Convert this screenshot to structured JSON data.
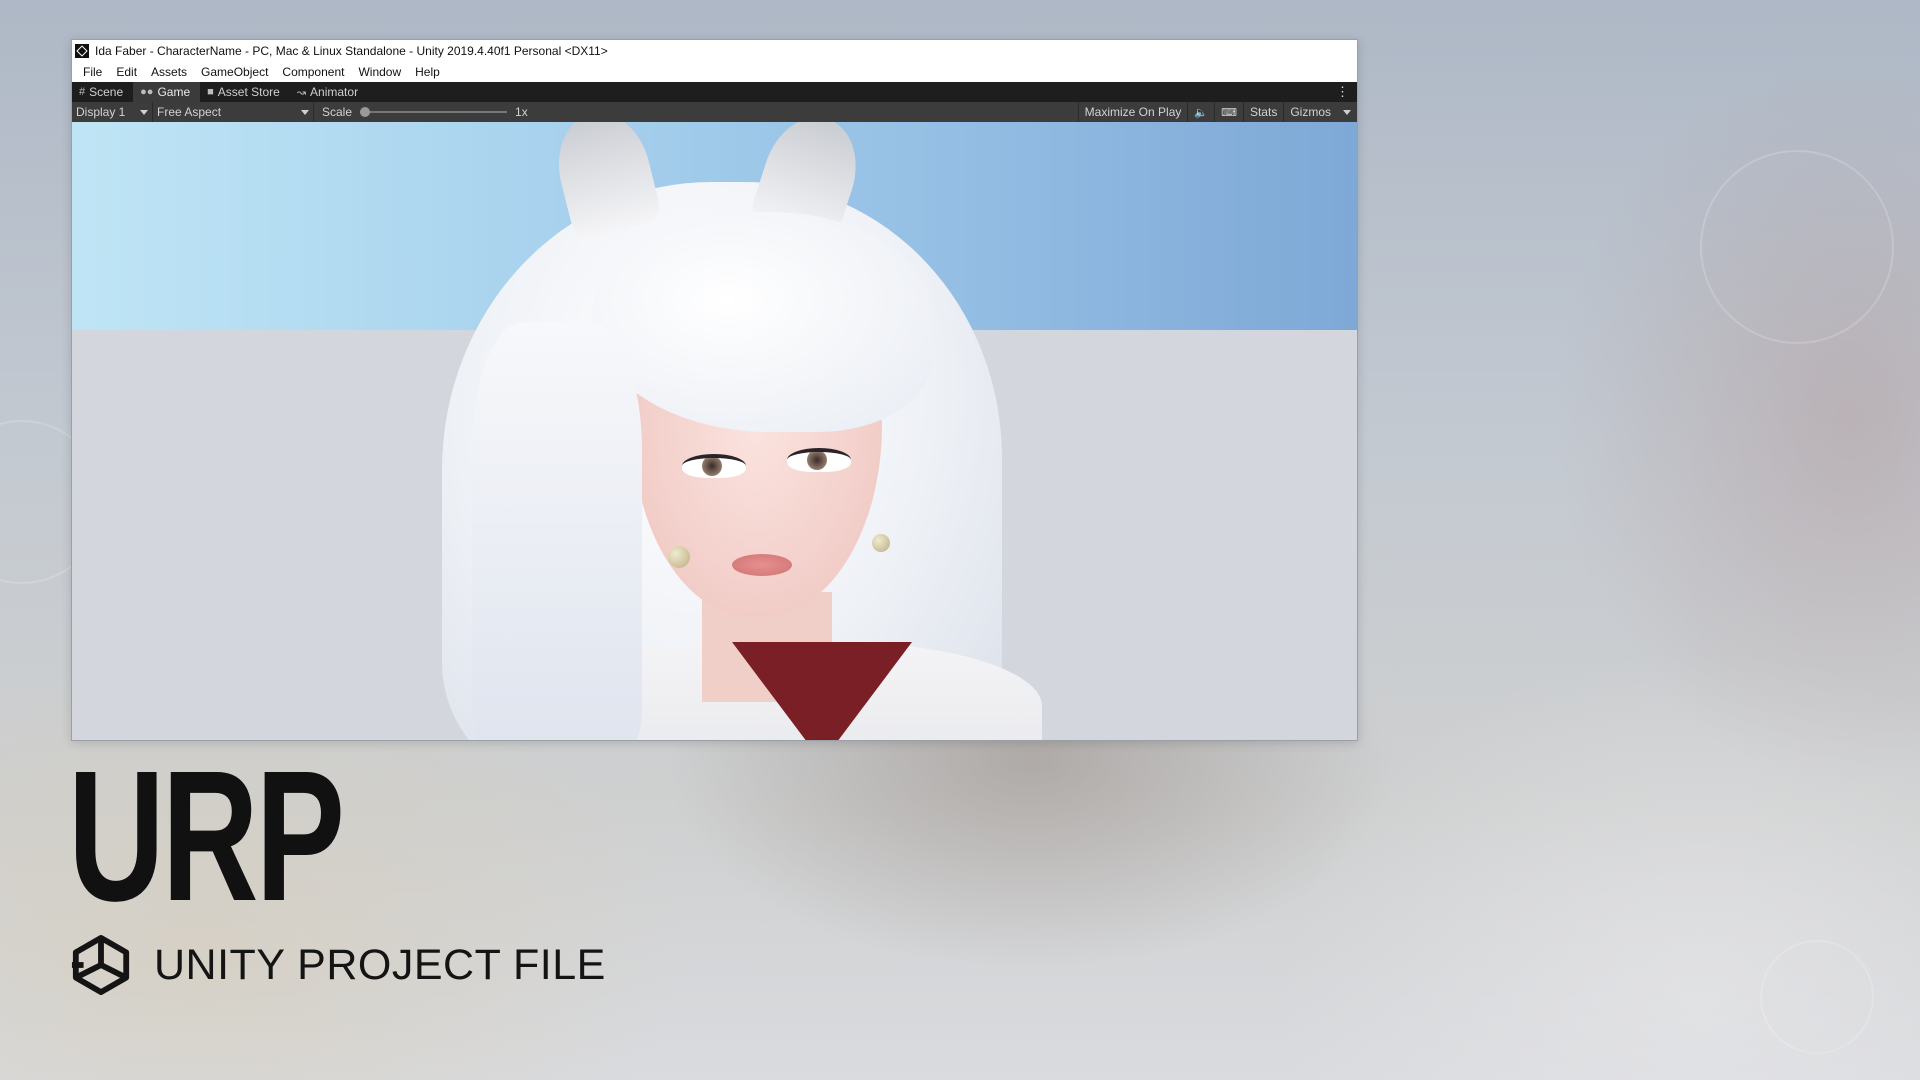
{
  "window": {
    "title": "Ida Faber - CharacterName - PC, Mac & Linux Standalone - Unity 2019.4.40f1 Personal <DX11>"
  },
  "menu": {
    "items": [
      {
        "label": "File"
      },
      {
        "label": "Edit"
      },
      {
        "label": "Assets"
      },
      {
        "label": "GameObject"
      },
      {
        "label": "Component"
      },
      {
        "label": "Window"
      },
      {
        "label": "Help"
      }
    ]
  },
  "tabs": [
    {
      "label": "Scene",
      "icon": "grid-icon"
    },
    {
      "label": "Game",
      "icon": "gamepad-icon",
      "active": true
    },
    {
      "label": "Asset Store",
      "icon": "bag-icon"
    },
    {
      "label": "Animator",
      "icon": "animator-icon"
    }
  ],
  "toolbar": {
    "display": "Display 1",
    "aspect": "Free Aspect",
    "scale_label": "Scale",
    "scale_value": "1x",
    "scale_slider_fraction": 0.0,
    "maximize": "Maximize On Play",
    "stats": "Stats",
    "gizmos": "Gizmos"
  },
  "branding": {
    "title": "URP",
    "subtitle": "UNITY PROJECT FILE"
  },
  "colors": {
    "tabbar": "#1e1e1e",
    "toolbar": "#3c3c3c",
    "sky": "#93bde3",
    "ground": "#d3d6dc"
  }
}
